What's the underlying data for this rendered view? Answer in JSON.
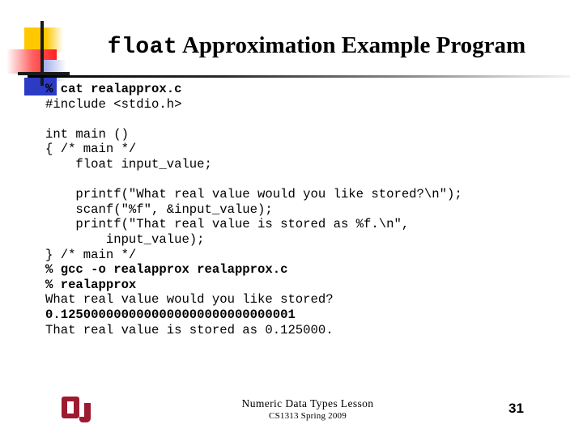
{
  "slide": {
    "title_mono": "float",
    "title_serif": " Approximation Example Program",
    "page_number": "31"
  },
  "logo": {
    "deco_name": "decorative-squares-logo",
    "ou_name": "ou-logo",
    "colors": {
      "yellow": "#FFC800",
      "red": "#FF2020",
      "blue": "#2B3BC4",
      "bar": "#1a1a1a",
      "crimson": "#9C1B31"
    }
  },
  "code": {
    "lines": [
      {
        "text": "% cat realapprox.c",
        "bold": true
      },
      {
        "text": "#include <stdio.h>",
        "bold": false
      },
      {
        "text": "",
        "bold": false
      },
      {
        "text": "int main ()",
        "bold": false
      },
      {
        "text": "{ /* main */",
        "bold": false
      },
      {
        "text": "    float input_value;",
        "bold": false
      },
      {
        "text": "",
        "bold": false
      },
      {
        "text": "    printf(\"What real value would you like stored?\\n\");",
        "bold": false
      },
      {
        "text": "    scanf(\"%f\", &input_value);",
        "bold": false
      },
      {
        "text": "    printf(\"That real value is stored as %f.\\n\",",
        "bold": false
      },
      {
        "text": "        input_value);",
        "bold": false
      },
      {
        "text": "} /* main */",
        "bold": false
      },
      {
        "text": "% gcc -o realapprox realapprox.c",
        "bold": true
      },
      {
        "text": "% realapprox",
        "bold": true
      },
      {
        "text": "What real value would you like stored?",
        "bold": false
      },
      {
        "text": "0.1250000000000000000000000000001",
        "bold": true
      },
      {
        "text": "That real value is stored as 0.125000.",
        "bold": false
      }
    ]
  },
  "footer": {
    "lesson": "Numeric Data Types Lesson",
    "course": "CS1313 Spring 2009"
  }
}
